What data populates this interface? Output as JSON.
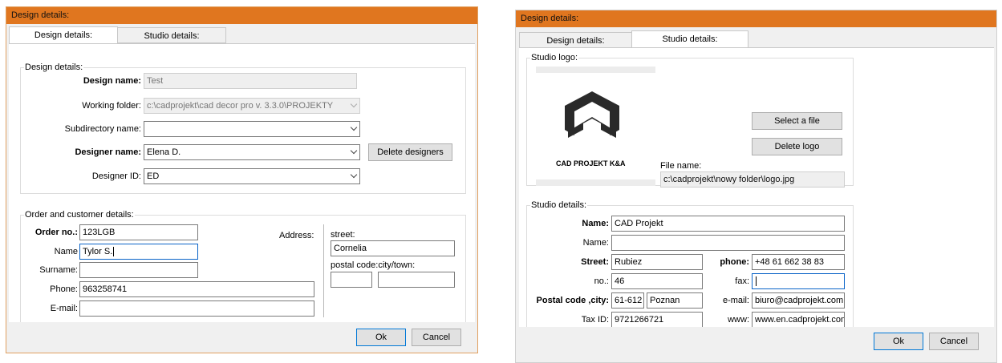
{
  "left": {
    "title": "Design details:",
    "tabs": [
      "Design details:",
      "Studio details:"
    ],
    "design_group": {
      "label": "Design details:",
      "design_name_label": "Design name:",
      "design_name_value": "Test",
      "working_folder_label": "Working folder:",
      "working_folder_value": "c:\\cadprojekt\\cad decor pro v. 3.3.0\\PROJEKTY",
      "subdirectory_label": "Subdirectory name:",
      "subdirectory_value": "",
      "designer_name_label": "Designer name:",
      "designer_name_value": "Elena D.",
      "delete_designers_label": "Delete designers",
      "designer_id_label": "Designer ID:",
      "designer_id_value": "ED"
    },
    "order_group": {
      "label": "Order and customer details:",
      "order_no_label": "Order no.:",
      "order_no_value": "123LGB",
      "name_label": "Name",
      "name_value": "Tylor S.",
      "surname_label": "Surname:",
      "surname_value": "",
      "phone_label": "Phone:",
      "phone_value": "963258741",
      "email_label": "E-mail:",
      "email_value": "",
      "address_label": "Address:",
      "street_label": "street:",
      "street_value": "Cornelia",
      "postal_city_label": "postal code:city/town:",
      "postal_value": "",
      "city_value": ""
    },
    "ok_label": "Ok",
    "cancel_label": "Cancel"
  },
  "right": {
    "title": "Design details:",
    "tabs": [
      "Design details:",
      "Studio details:"
    ],
    "logo_group": {
      "label": "Studio logo:",
      "logo_text": "CAD PROJEKT K&A",
      "select_file_label": "Select a file",
      "delete_logo_label": "Delete logo",
      "file_name_label": "File name:",
      "file_name_value": "c:\\cadprojekt\\nowy folder\\logo.jpg"
    },
    "studio_group": {
      "label": "Studio details:",
      "name1_label": "Name:",
      "name1_value": "CAD Projekt",
      "name2_label": "Name:",
      "name2_value": "",
      "street_label": "Street:",
      "street_value": "Rubiez",
      "no_label": "no.:",
      "no_value": "46",
      "postal_city_label": "Postal code ,city:",
      "postal_value": "61-612",
      "city_value": "Poznan",
      "taxid_label": "Tax ID:",
      "taxid_value": "9721266721",
      "phone_label": "phone:",
      "phone_value": "+48 61 662 38 83",
      "fax_label": "fax:",
      "fax_value": "",
      "email_label": "e-mail:",
      "email_value": "biuro@cadprojekt.com",
      "www_label": "www:",
      "www_value": "www.en.cadprojekt.com"
    },
    "ok_label": "Ok",
    "cancel_label": "Cancel"
  }
}
